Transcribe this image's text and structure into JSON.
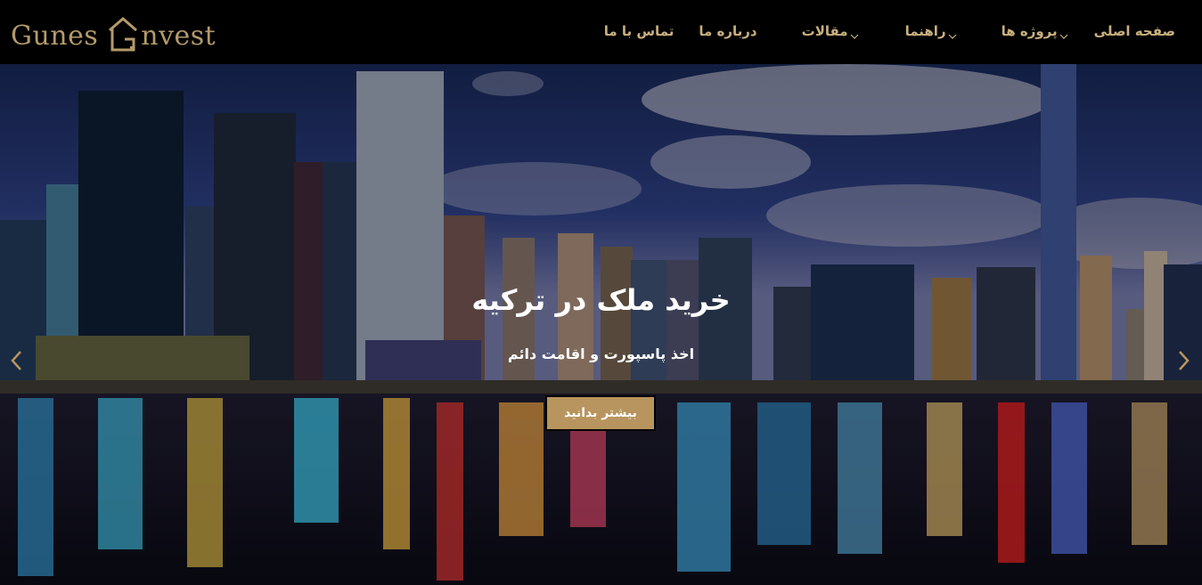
{
  "brand": {
    "logo_text_left": "Gunes",
    "logo_text_right": "nvest",
    "accent": "#b49a6a"
  },
  "nav": {
    "items": [
      {
        "label": "صفحه اصلی",
        "has_dropdown": false
      },
      {
        "label": "پروژه ها",
        "has_dropdown": true
      },
      {
        "label": "راهنما",
        "has_dropdown": true
      },
      {
        "label": "مقالات",
        "has_dropdown": true
      },
      {
        "label": "درباره ما",
        "has_dropdown": false
      },
      {
        "label": "تماس با ما",
        "has_dropdown": false
      }
    ]
  },
  "hero": {
    "title": "خرید ملک در ترکیه",
    "subtitle": "اخذ پاسپورت و اقامت دائم",
    "cta_label": "بیشتر بدانید",
    "cta_color": "#b8955e",
    "arrow_color": "#b8955e"
  }
}
